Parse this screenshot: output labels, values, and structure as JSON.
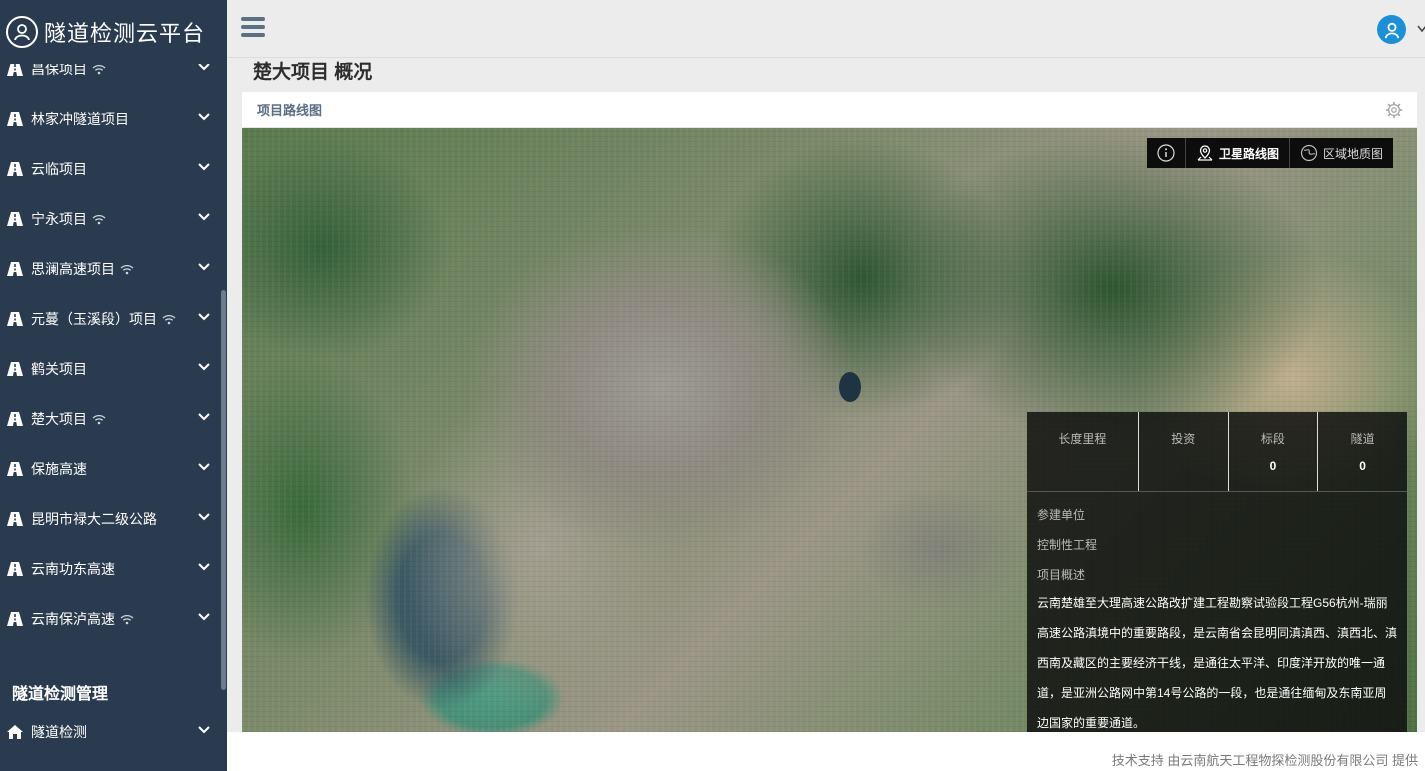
{
  "brand": {
    "title": "隧道检测云平台"
  },
  "sidebar": {
    "items": [
      {
        "label": "昌保项目",
        "wifi": true
      },
      {
        "label": "林家冲隧道项目",
        "wifi": false
      },
      {
        "label": "云临项目",
        "wifi": false
      },
      {
        "label": "宁永项目",
        "wifi": true
      },
      {
        "label": "思澜高速项目",
        "wifi": true
      },
      {
        "label": "元蔓（玉溪段）项目",
        "wifi": true
      },
      {
        "label": "鹤关项目",
        "wifi": false
      },
      {
        "label": "楚大项目",
        "wifi": true
      },
      {
        "label": "保施高速",
        "wifi": false
      },
      {
        "label": "昆明市禄大二级公路",
        "wifi": false
      },
      {
        "label": "云南功东高速",
        "wifi": false
      },
      {
        "label": "云南保泸高速",
        "wifi": true
      }
    ],
    "section_title": "隧道检测管理",
    "detect_label": "隧道检测"
  },
  "page": {
    "title": "楚大项目 概况"
  },
  "panel": {
    "title": "项目路线图"
  },
  "map_toolbar": {
    "satellite_label": "卫星路线图",
    "region_label": "区域地质图"
  },
  "info": {
    "stats": [
      {
        "label": "长度里程",
        "value": ""
      },
      {
        "label": "投资",
        "value": ""
      },
      {
        "label": "标段",
        "value": "0"
      },
      {
        "label": "隧道",
        "value": "0"
      }
    ],
    "unit_label": "参建单位",
    "control_label": "控制性工程",
    "overview_label": "项目概述",
    "description": "云南楚雄至大理高速公路改扩建工程勘察试验段工程G56杭州-瑞丽高速公路滇境中的重要路段，是云南省会昆明同滇滇西、滇西北、滇西南及藏区的主要经济干线，是通往太平洋、印度洋开放的唯一通道，是亚洲公路网中第14号公路的一段，也是通往缅甸及东南亚周边国家的重要通道。"
  },
  "footer": {
    "text": "技术支持 由云南航天工程物探检测股份有限公司 提供"
  },
  "colors": {
    "sidebar_bg": "#2a3b4f",
    "avatar": "#1c8fd6",
    "header_bg": "#ececec"
  }
}
